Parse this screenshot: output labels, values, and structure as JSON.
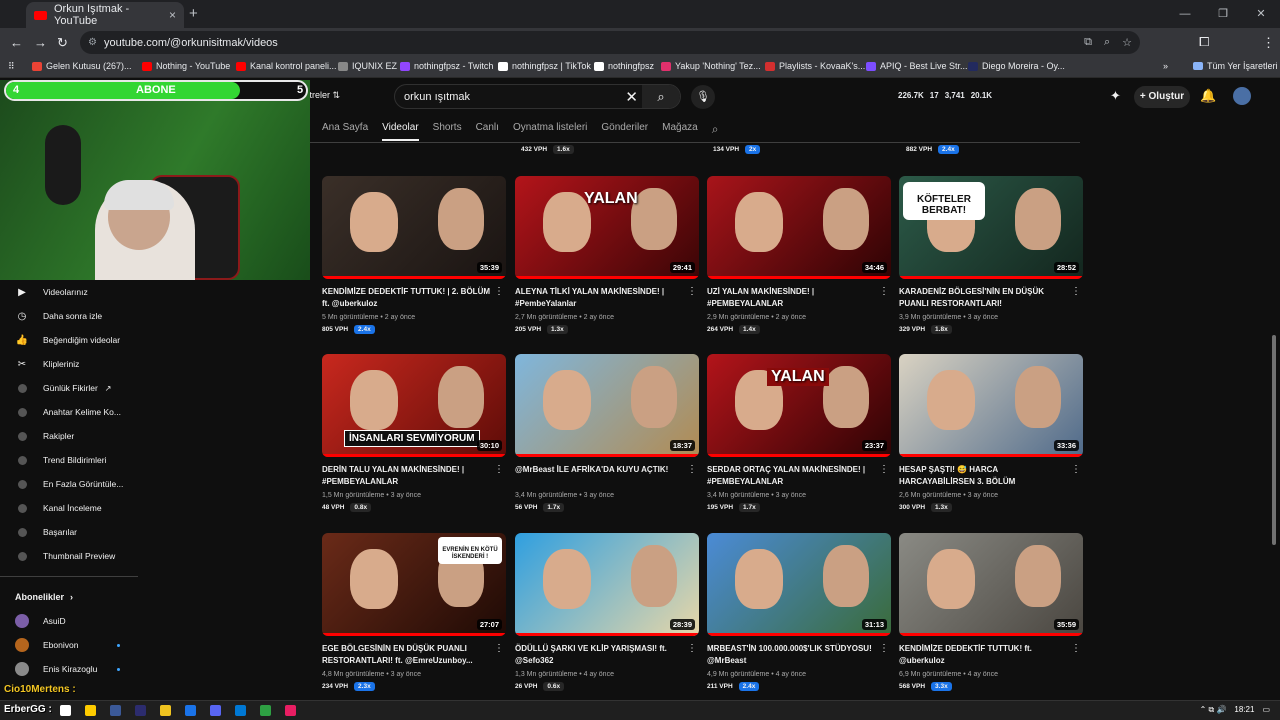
{
  "browser": {
    "tab_title": "Orkun Işıtmak - YouTube",
    "tab_close": "×",
    "new_tab": "+",
    "url": "youtube.com/@orkunisitmak/videos",
    "profile_letter": "Y",
    "window_controls": [
      "—",
      "❐",
      "✕"
    ],
    "bookmarks": [
      {
        "label": "Gelen Kutusu (267)...",
        "color": "#ea4335"
      },
      {
        "label": "Nothing - YouTube",
        "color": "#ff0000"
      },
      {
        "label": "Kanal kontrol paneli...",
        "color": "#ff0000"
      },
      {
        "label": "IQUNIX EZ",
        "color": "#888888"
      },
      {
        "label": "nothingfpsz - Twitch",
        "color": "#9146ff"
      },
      {
        "label": "nothingfpsz | TikTok",
        "color": "#ffffff"
      },
      {
        "label": "nothingfpsz",
        "color": "#ffffff"
      },
      {
        "label": "Yakup 'Nothing' Tez...",
        "color": "#e1306c"
      },
      {
        "label": "Playlists - KovaaK's...",
        "color": "#d32f2f"
      },
      {
        "label": "APIQ - Best Live Str...",
        "color": "#7c4dff"
      },
      {
        "label": "Diego Moreira - Oy...",
        "color": "#222a5e"
      }
    ],
    "bookmarks_overflow": "»",
    "all_bookmarks": "Tüm Yer İşaretleri"
  },
  "youtube": {
    "filters_label": "Filtreler",
    "search_value": "orkun ışıtmak",
    "create_label": "Oluştur",
    "stats": [
      "226.7K",
      "17",
      "3,741",
      "20.1K"
    ],
    "channel_tabs": [
      "Ana Sayfa",
      "Videolar",
      "Shorts",
      "Canlı",
      "Oynatma listeleri",
      "Gönderiler",
      "Mağaza"
    ],
    "active_tab": "Videolar",
    "prev_row": [
      {
        "vph": "432 VPH",
        "mult": "1.6x",
        "blue": false
      },
      {
        "vph": "134 VPH",
        "mult": "2x",
        "blue": true
      },
      {
        "vph": "882 VPH",
        "mult": "2.4x",
        "blue": true
      }
    ]
  },
  "overlay": {
    "abone_left": "4",
    "abone_center": "ABONE",
    "abone_right": "5",
    "abone_progress": 0.78,
    "chat_line1": "Cio10Mertens :",
    "chat_line2": "ErberGG :"
  },
  "sidebar": {
    "items": [
      {
        "label": "Videolarınız",
        "icon": "▶",
        "name": "your-videos"
      },
      {
        "label": "Daha sonra izle",
        "icon": "◷",
        "name": "watch-later"
      },
      {
        "label": "Beğendiğim videolar",
        "icon": "👍",
        "name": "liked-videos"
      },
      {
        "label": "Klipleriniz",
        "icon": "✂",
        "name": "your-clips"
      },
      {
        "label": "Günlük Fikirler",
        "icon": "dot",
        "name": "daily-ideas",
        "external": true
      },
      {
        "label": "Anahtar Kelime Ko...",
        "icon": "dot",
        "name": "keyword"
      },
      {
        "label": "Rakipler",
        "icon": "dot",
        "name": "competitors"
      },
      {
        "label": "Trend Bildirimleri",
        "icon": "dot",
        "name": "trend-alerts"
      },
      {
        "label": "En Fazla Görüntüle...",
        "icon": "dot",
        "name": "most-viewed"
      },
      {
        "label": "Kanal İnceleme",
        "icon": "dot",
        "name": "channel-review"
      },
      {
        "label": "Başarılar",
        "icon": "dot",
        "name": "achievements"
      },
      {
        "label": "Thumbnail Preview",
        "icon": "dot",
        "name": "thumbnail-preview"
      }
    ],
    "subs_header": "Abonelikler",
    "subs": [
      {
        "label": "AsuiD",
        "color": "#7b5ea7",
        "dot": false
      },
      {
        "label": "Ebonivon",
        "color": "#b5651d",
        "dot": true
      },
      {
        "label": "Enis Kirazoglu",
        "color": "#8a8a8a",
        "dot": true
      }
    ]
  },
  "videos": [
    {
      "title": "KENDİMİZE DEDEKTİF TUTTUK! | 2. BÖLÜM ft. @uberkuloz",
      "views": "5 Mn görüntüleme",
      "age": "2 ay önce",
      "vph": "805 VPH",
      "mult": "2.4x",
      "blue": true,
      "duration": "35:39",
      "bg": "#3a2f28",
      "bg2": "#1a1412",
      "overlay": ""
    },
    {
      "title": "ALEYNA TİLKİ YALAN MAKİNESİNDE! | #PembeYalanlar",
      "views": "2,7 Mn görüntüleme",
      "age": "2 ay önce",
      "vph": "205 VPH",
      "mult": "1.3x",
      "blue": false,
      "duration": "29:41",
      "bg": "#b3141a",
      "bg2": "#3a0506",
      "overlay": "YALAN"
    },
    {
      "title": "UZİ YALAN MAKİNESİNDE! | #PEMBEYALANLAR",
      "views": "2,9 Mn görüntüleme",
      "age": "2 ay önce",
      "vph": "264 VPH",
      "mult": "1.4x",
      "blue": false,
      "duration": "34:46",
      "bg": "#a8141a",
      "bg2": "#2d0304",
      "overlay": ""
    },
    {
      "title": "KARADENİZ BÖLGESİ'NİN EN DÜŞÜK PUANLI RESTORANTLARI!",
      "views": "3,9 Mn görüntüleme",
      "age": "3 ay önce",
      "vph": "329 VPH",
      "mult": "1.8x",
      "blue": false,
      "duration": "28:52",
      "bg": "#2c5a48",
      "bg2": "#13261e",
      "overlay": "KÖFTELER BERBAT!"
    },
    {
      "title": "DERİN TALU YALAN MAKİNESİNDE! | #PEMBEYALANLAR",
      "views": "1,5 Mn görüntüleme",
      "age": "3 ay önce",
      "vph": "48 VPH",
      "mult": "0.8x",
      "blue": false,
      "duration": "30:10",
      "bg": "#c8281e",
      "bg2": "#5e0c08",
      "overlay": "İNSANLARI SEVMİYORUM"
    },
    {
      "title": "@MrBeast İLE AFRİKA'DA KUYU AÇTIK!",
      "views": "3,4 Mn görüntüleme",
      "age": "3 ay önce",
      "vph": "56 VPH",
      "mult": "1.7x",
      "blue": false,
      "duration": "18:37",
      "bg": "#7fb6dc",
      "bg2": "#b28b52",
      "overlay": ""
    },
    {
      "title": "SERDAR ORTAÇ YALAN MAKİNESİNDE! | #PEMBEYALANLAR",
      "views": "3,4 Mn görüntüleme",
      "age": "3 ay önce",
      "vph": "195 VPH",
      "mult": "1.7x",
      "blue": false,
      "duration": "23:37",
      "bg": "#b3141a",
      "bg2": "#2d0304",
      "overlay": "YALAN"
    },
    {
      "title": "HESAP ŞAŞTI! 😅 HARCA HARCAYABİLİRSEN 3. BÖLÜM",
      "views": "2,6 Mn görüntüleme",
      "age": "3 ay önce",
      "vph": "300 VPH",
      "mult": "1.3x",
      "blue": false,
      "duration": "33:36",
      "bg": "#d9d2c2",
      "bg2": "#4f6a8a",
      "overlay": ""
    },
    {
      "title": "EGE BÖLGESİNİN EN DÜŞÜK PUANLI RESTORANTLARI! ft. @EmreUzunboy...",
      "views": "4,8 Mn görüntüleme",
      "age": "3 ay önce",
      "vph": "234 VPH",
      "mult": "2.3x",
      "blue": true,
      "duration": "27:07",
      "bg": "#6a2a18",
      "bg2": "#1e0a05",
      "overlay": "EVRENİN EN KÖTÜ İSKENDERİ !"
    },
    {
      "title": "ÖDÜLLÜ ŞARKI VE KLİP YARIŞMASI! ft. @Sefo362",
      "views": "1,3 Mn görüntüleme",
      "age": "4 ay önce",
      "vph": "26 VPH",
      "mult": "0.6x",
      "blue": false,
      "duration": "28:39",
      "bg": "#2f9fe0",
      "bg2": "#e8d7a8",
      "overlay": ""
    },
    {
      "title": "MRBEAST'İN 100.000.000$'LIK STÜDYOSU! @MrBeast",
      "views": "4,9 Mn görüntüleme",
      "age": "4 ay önce",
      "vph": "211 VPH",
      "mult": "2.4x",
      "blue": true,
      "duration": "31:13",
      "bg": "#4b8bd6",
      "bg2": "#3a6b3a",
      "overlay": ""
    },
    {
      "title": "KENDİMİZE DEDEKTİF TUTTUK! ft. @uberkuloz",
      "views": "6,9 Mn görüntüleme",
      "age": "4 ay önce",
      "vph": "568 VPH",
      "mult": "3.3x",
      "blue": true,
      "duration": "35:59",
      "bg": "#8a8a84",
      "bg2": "#4a4640",
      "overlay": ""
    }
  ],
  "taskbar": {
    "time": "18:21",
    "icons": [
      "#ffffff",
      "#ffcc00",
      "#3b5998",
      "#2c2c6e",
      "#f0c420",
      "#1a73e8",
      "#5865f2",
      "#0078d4",
      "#2ea043",
      "#e91e63"
    ]
  }
}
